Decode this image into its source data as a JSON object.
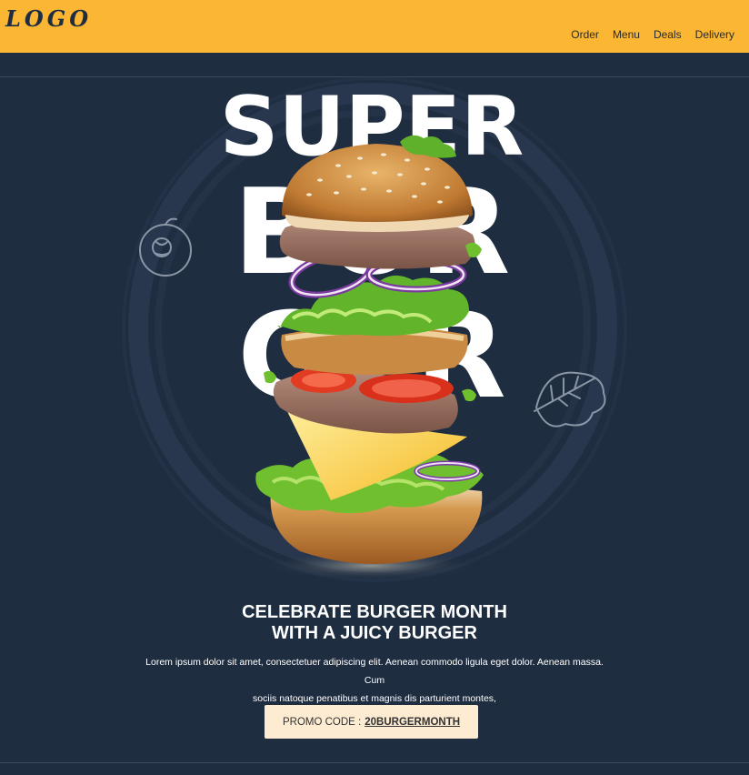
{
  "header": {
    "logo": "LOGO",
    "nav": [
      "Order",
      "Menu",
      "Deals",
      "Delivery"
    ]
  },
  "hero": {
    "title_line1": "SUPER",
    "title_line2": "BUR",
    "title_line3": "GER",
    "headline_line1": "CELEBRATE BURGER MONTH",
    "headline_line2": "WITH A JUICY BURGER",
    "body_line1": "Lorem ipsum dolor sit amet, consectetuer adipiscing elit. Aenean commodo ligula eget dolor. Aenean massa. Cum",
    "body_line2": "sociis natoque penatibus et magnis dis parturient montes,",
    "promo_label": "PROMO CODE :",
    "promo_code": "20BURGERMONTH"
  },
  "colors": {
    "header_bg": "#fbb733",
    "page_bg": "#1f2d41",
    "promo_bg": "#fdebd2"
  },
  "icons": [
    "tomato-icon",
    "lettuce-leaf-icon"
  ]
}
